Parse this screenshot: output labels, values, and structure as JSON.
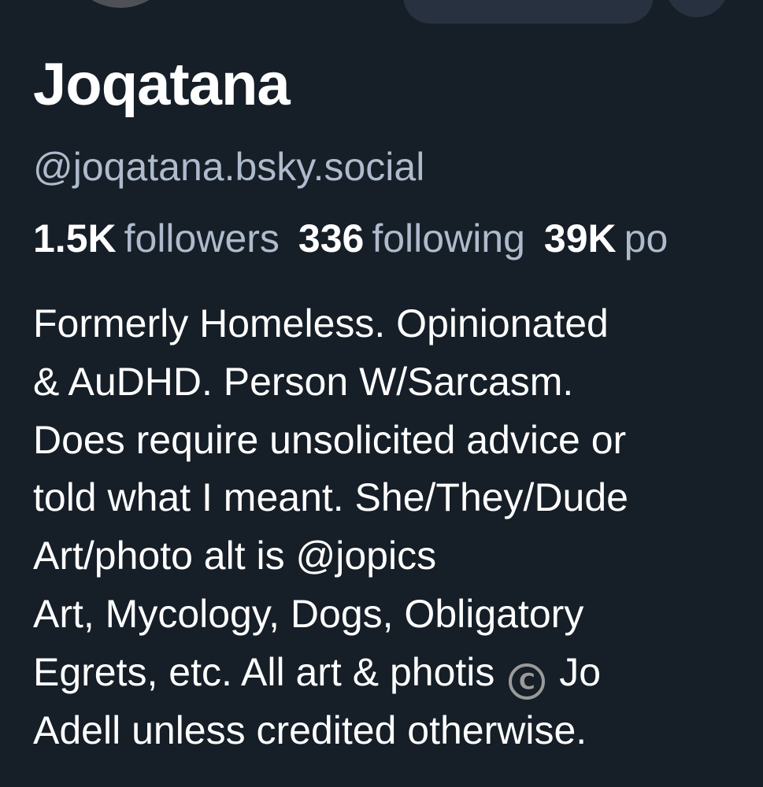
{
  "profile": {
    "display_name": "Joqatana",
    "handle": "@joqatana.bsky.social"
  },
  "stats": {
    "followers_count": "1.5K",
    "followers_label": "followers",
    "following_count": "336",
    "following_label": "following",
    "posts_count": "39K",
    "posts_label": "po"
  },
  "bio": {
    "lines": [
      "Formerly Homeless. Opinionated",
      "& AuDHD. Person W/Sarcasm.",
      "Does require unsolicited advice or",
      "told what I meant. She/They/Dude",
      "Art/photo alt is @jopics",
      "Art, Mycology, Dogs, Obligatory"
    ],
    "line7_before_icon": "Egrets, etc. All art & photis",
    "copyright_icon": "copyright-icon",
    "line7_after_icon": "Jo",
    "line8": "Adell unless credited otherwise."
  },
  "colors": {
    "background": "#161e27",
    "primary_text": "#ffffff",
    "secondary_text": "#aebbcc",
    "button_bg": "#27313f"
  }
}
